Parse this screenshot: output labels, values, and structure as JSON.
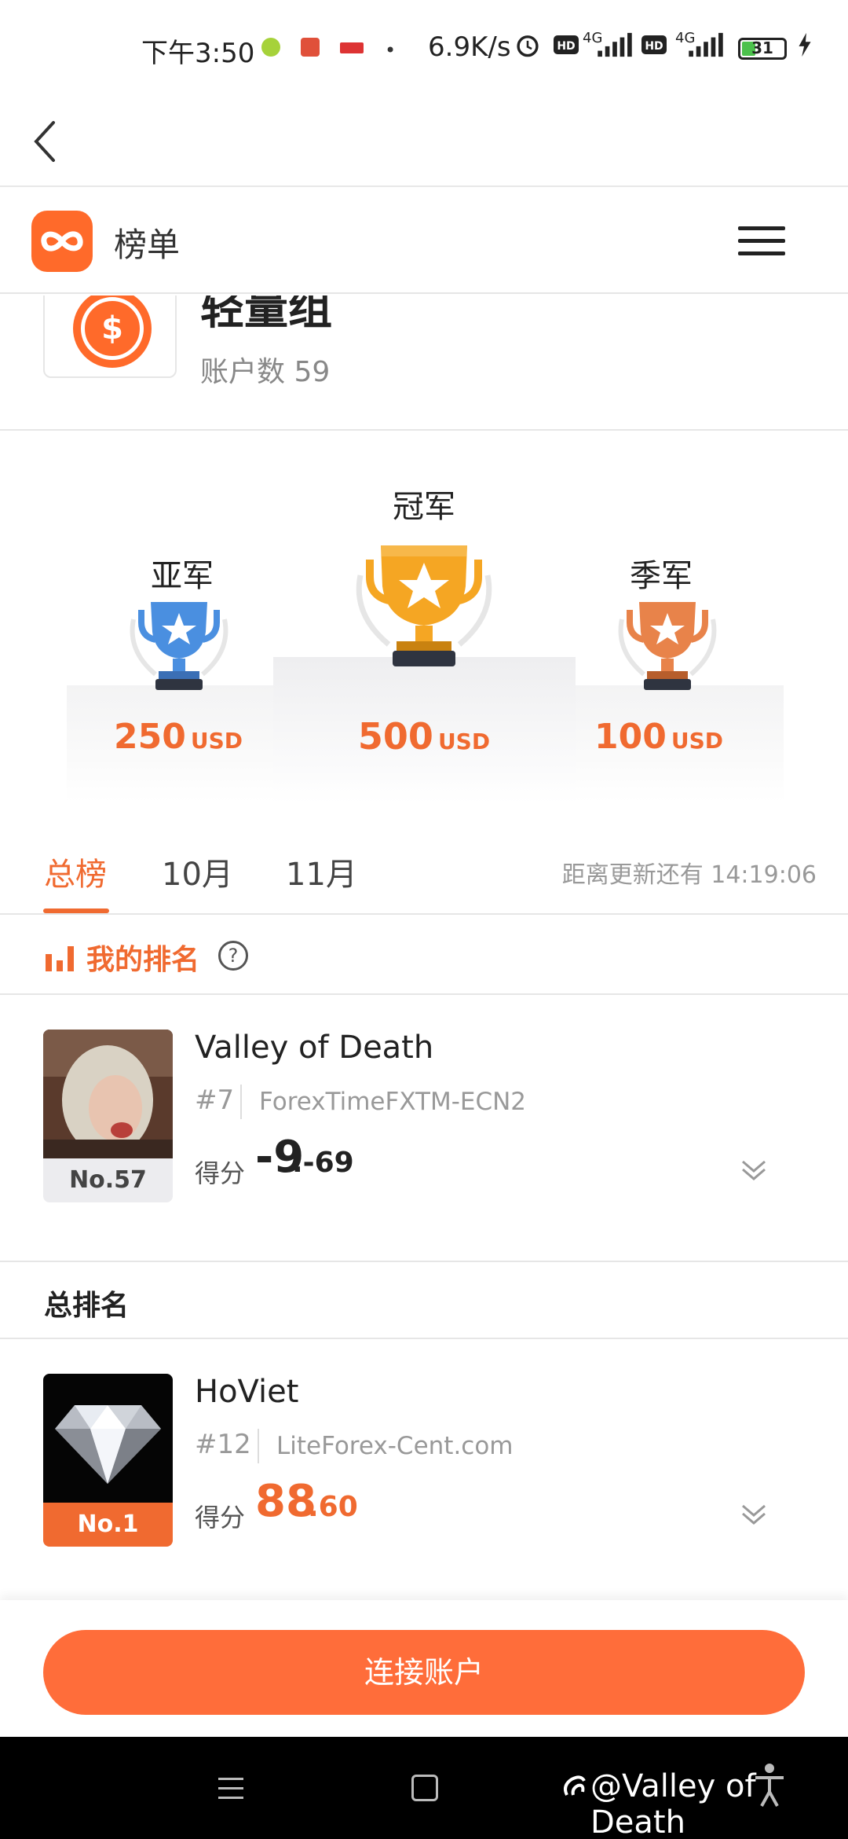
{
  "status_bar": {
    "time": "下午3:50",
    "net_speed": "6.9K/s",
    "battery_level": "31",
    "network_1": "4G",
    "network_2": "4G"
  },
  "header": {
    "title": "榜单"
  },
  "group": {
    "name": "轻量组",
    "account_count": "账户数 59",
    "icon": "dollar-coin-icon"
  },
  "podium": {
    "second": {
      "label": "亚军",
      "amount": "250",
      "currency": "USD"
    },
    "first": {
      "label": "冠军",
      "amount": "500",
      "currency": "USD"
    },
    "third": {
      "label": "季军",
      "amount": "100",
      "currency": "USD"
    }
  },
  "tabs": {
    "items": [
      "总榜",
      "10月",
      "11月"
    ],
    "active": "总榜",
    "countdown": "距离更新还有 14:19:06"
  },
  "my_rank": {
    "title": "我的排名",
    "name": "Valley of Death",
    "rank": "#7",
    "broker": "ForexTimeFXTM-ECN2",
    "position": "No.57",
    "score_label": "得分",
    "score_int": "-9",
    "score_dec": ".-69"
  },
  "overall": {
    "title": "总排名",
    "entries": [
      {
        "name": "HoViet",
        "rank": "#12",
        "broker": "LiteForex-Cent.com",
        "position": "No.1",
        "score_label": "得分",
        "score_int": "88",
        "score_dec": ".60"
      }
    ]
  },
  "footer": {
    "connect_label": "连接账户"
  },
  "system_nav": {
    "watermark": "@Valley of Death"
  },
  "colors": {
    "accent": "#f06a30",
    "button": "#ff6d3a",
    "gold": "#f5a623",
    "silver": "#4a8fe0",
    "bronze": "#e8834a"
  }
}
